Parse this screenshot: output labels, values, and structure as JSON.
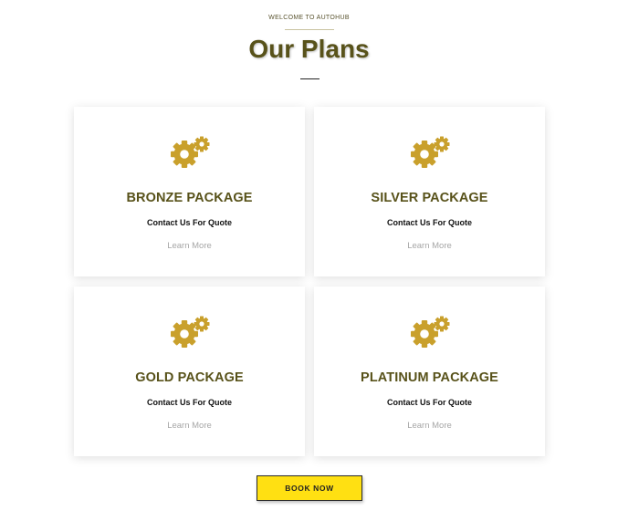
{
  "header": {
    "eyebrow": "WELCOME TO AUTOHUB",
    "title": "Our Plans"
  },
  "plans": [
    {
      "name": "BRONZE PACKAGE",
      "quote": "Contact Us For Quote",
      "link": "Learn More",
      "icon": "gears-icon"
    },
    {
      "name": "SILVER PACKAGE",
      "quote": "Contact Us For Quote",
      "link": "Learn More",
      "icon": "gears-icon"
    },
    {
      "name": "GOLD PACKAGE",
      "quote": "Contact Us For Quote",
      "link": "Learn More",
      "icon": "gears-icon"
    },
    {
      "name": "PLATINUM PACKAGE",
      "quote": "Contact Us For Quote",
      "link": "Learn More",
      "icon": "gears-icon"
    }
  ],
  "cta": {
    "label": "BOOK NOW"
  },
  "colors": {
    "title": "#58521a",
    "icon": "#c9a02c",
    "button": "#ffe012"
  }
}
